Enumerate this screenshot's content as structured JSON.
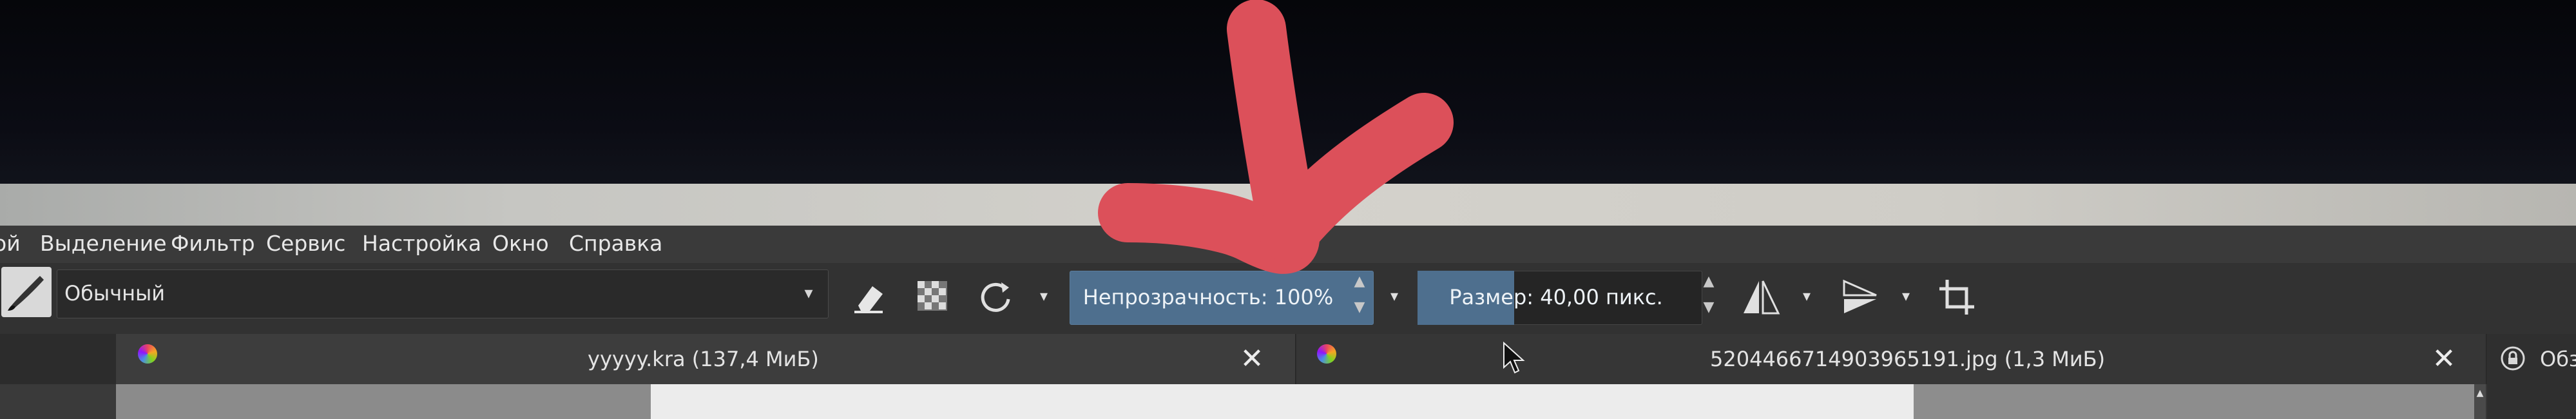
{
  "menu": {
    "items": [
      {
        "id": "partial",
        "label": "ой"
      },
      {
        "id": "select",
        "label": "Выделение"
      },
      {
        "id": "filter",
        "label": "Фильтр"
      },
      {
        "id": "tools",
        "label": "Сервис"
      },
      {
        "id": "settings",
        "label": "Настройка"
      },
      {
        "id": "window",
        "label": "Окно"
      },
      {
        "id": "help",
        "label": "Справка"
      }
    ]
  },
  "toolbar": {
    "brush_preset": "Обычный",
    "opacity_label": "Непрозрачность: 100%",
    "opacity_value": 1.0,
    "size_label": "Размер: 40,00 пикс.",
    "icons": {
      "preset": "brush-preset-icon",
      "eraser": "eraser-icon",
      "alpha": "alpha-lock-icon",
      "reload": "reload-preset-icon",
      "mirror_h": "mirror-horizontal-icon",
      "mirror_v": "mirror-vertical-icon",
      "crop": "crop-icon"
    }
  },
  "tabs": [
    {
      "label": "yyyyy.kra (137,4 МиБ)",
      "close": "✕"
    },
    {
      "label": "5204466714903965191.jpg (1,3 МиБ)",
      "close": "✕"
    }
  ],
  "right_panel": {
    "label": "Обз"
  },
  "colors": {
    "annotation": "#dc505a",
    "accent": "#4e6f8e",
    "window_bg": "#373737"
  }
}
